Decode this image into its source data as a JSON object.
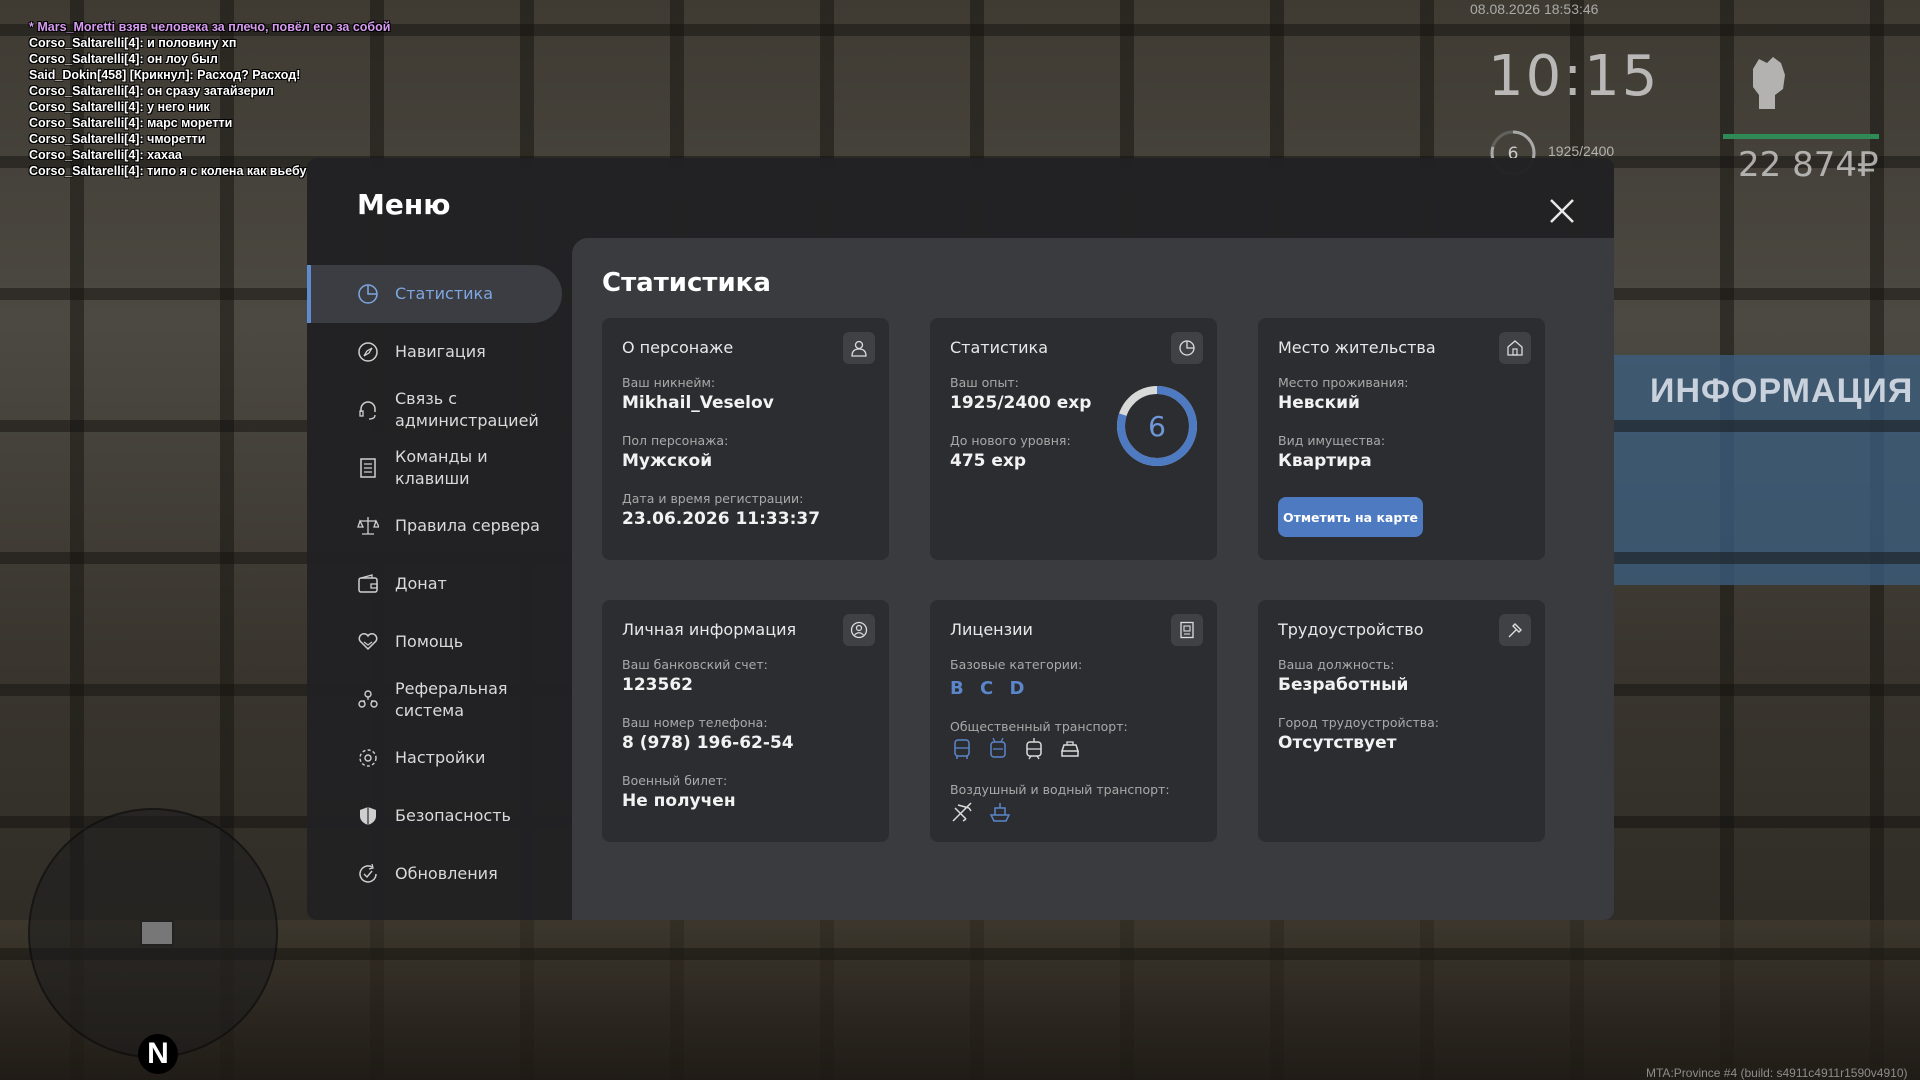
{
  "chat": [
    {
      "text": "* Mars_Moretti взяв человека за плечо, повёл его за собой",
      "me": true
    },
    {
      "text": "Corso_Saltarelli[4]: и половину хп"
    },
    {
      "text": "Corso_Saltarelli[4]: он лоу был"
    },
    {
      "text": "Said_Dokin[458] [Крикнул]: Расход? Расход!"
    },
    {
      "text": "Corso_Saltarelli[4]: он сразу затайзерил"
    },
    {
      "text": "Corso_Saltarelli[4]: у него ник"
    },
    {
      "text": "Corso_Saltarelli[4]: марс моретти"
    },
    {
      "text": "Corso_Saltarelli[4]: чморетти"
    },
    {
      "text": "Corso_Saltarelli[4]: хахаа"
    },
    {
      "text": "Corso_Saltarelli[4]: типо я с колена как вьебу"
    }
  ],
  "hud": {
    "datetime": "08.08.2026 18:53:46",
    "clock": "10:15",
    "level": "6",
    "exp": "1925/2400",
    "money": "22 874₽",
    "board_text": "ИНФОРМАЦИЯ",
    "north": "N",
    "build": "MTA:Province #4 (build: s4911c4911r1590v4910)"
  },
  "menu": {
    "title": "Меню",
    "nav": [
      {
        "label": "Статистика",
        "icon": "chart-pie-icon",
        "active": true
      },
      {
        "label": "Навигация",
        "icon": "compass-icon"
      },
      {
        "label": "Связь с администрацией",
        "icon": "headset-icon"
      },
      {
        "label": "Команды и клавиши",
        "icon": "document-list-icon"
      },
      {
        "label": "Правила сервера",
        "icon": "scales-icon"
      },
      {
        "label": "Донат",
        "icon": "wallet-icon"
      },
      {
        "label": "Помощь",
        "icon": "heart-hands-icon"
      },
      {
        "label": "Реферальная система",
        "icon": "people-icon"
      },
      {
        "label": "Настройки",
        "icon": "gear-icon"
      },
      {
        "label": "Безопасность",
        "icon": "shield-icon"
      },
      {
        "label": "Обновления",
        "icon": "refresh-check-icon"
      }
    ],
    "section_title": "Статистика",
    "character": {
      "title": "О персонаже",
      "nick_label": "Ваш никнейм:",
      "nick": "Mikhail_Veselov",
      "gender_label": "Пол персонажа:",
      "gender": "Мужской",
      "reg_label": "Дата и время регистрации:",
      "reg": "23.06.2026 11:33:37"
    },
    "stats": {
      "title": "Статистика",
      "exp_label": "Ваш опыт:",
      "exp": "1925/2400 exp",
      "next_label": "До нового уровня:",
      "next": "475 exp",
      "level": "6",
      "progress": 0.8
    },
    "residence": {
      "title": "Место жительства",
      "place_label": "Место проживания:",
      "place": "Невский",
      "type_label": "Вид имущества:",
      "type": "Квартира",
      "button": "Отметить на карте"
    },
    "personal": {
      "title": "Личная информация",
      "bank_label": "Ваш банковский счет:",
      "bank": "123562",
      "phone_label": "Ваш номер телефона:",
      "phone": "8 (978) 196-62-54",
      "military_label": "Военный билет:",
      "military": "Не получен"
    },
    "licenses": {
      "title": "Лицензии",
      "base_label": "Базовые категории:",
      "categories": [
        "B",
        "C",
        "D"
      ],
      "public_label": "Общественный транспорт:",
      "air_label": "Воздушный и водный транспорт:"
    },
    "job": {
      "title": "Трудоустройство",
      "position_label": "Ваша должность:",
      "position": "Безработный",
      "city_label": "Город трудоустройства:",
      "city": "Отсутствует"
    }
  },
  "colors": {
    "accent": "#5f8ccc",
    "button": "#4e7ac2",
    "chat_me": "#d69bf0",
    "hud_bar": "#2f8a56"
  }
}
